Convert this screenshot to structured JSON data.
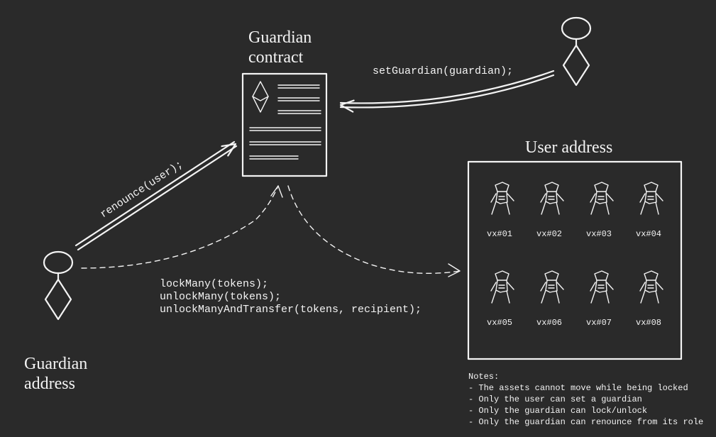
{
  "guardianContractLabel1": "Guardian",
  "guardianContractLabel2": "contract",
  "guardianAddressLabel1": "Guardian",
  "guardianAddressLabel2": "address",
  "userAddressLabel": "User address",
  "arrowRenounce": "renounce(user);",
  "arrowSetGuardian": "setGuardian(guardian);",
  "fn1": "lockMany(tokens);",
  "fn2": "unlockMany(tokens);",
  "fn3": "unlockManyAndTransfer(tokens, recipient);",
  "tokens": [
    "vx#01",
    "vx#02",
    "vx#03",
    "vx#04",
    "vx#05",
    "vx#06",
    "vx#07",
    "vx#08"
  ],
  "notesTitle": "Notes:",
  "notes": [
    "- The assets cannot move while being locked",
    "- Only the user can set a guardian",
    "- Only the guardian can lock/unlock",
    "- Only the guardian can renounce from its role"
  ]
}
